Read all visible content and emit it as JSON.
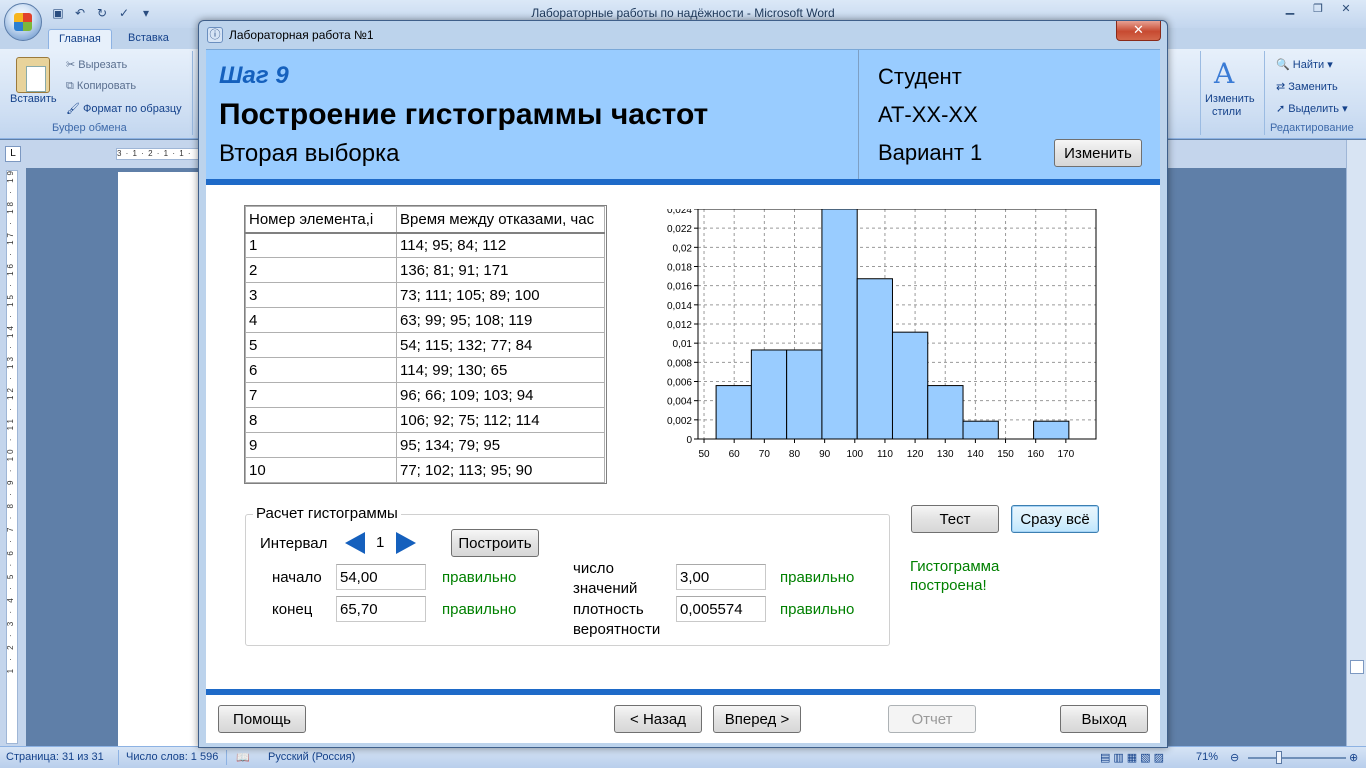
{
  "word": {
    "title": "Лабораторные работы по надёжности - Microsoft Word",
    "tabs": [
      "Главная",
      "Вставка"
    ],
    "clipboard": {
      "paste": "Вставить",
      "cut": "Вырезать",
      "copy": "Копировать",
      "format_painter": "Формат по образцу",
      "group_label": "Буфер обмена"
    },
    "styles": {
      "change_styles_line1": "Изменить",
      "change_styles_line2": "стили"
    },
    "editing": {
      "find": "Найти",
      "replace": "Заменить",
      "select": "Выделить",
      "group_label": "Редактирование"
    },
    "ruler_text": "3 · 1 · 2 · 1 · 1 ·",
    "left_ruler_text": "1 · 2 · 3 · 4 · 5 · 6 · 7 · 8 · 9 · 10 · 11 · 12 · 13 · 14 · 15 · 16 · 17 · 18 · 19",
    "status": {
      "page": "Страница: 31 из 31",
      "words": "Число слов: 1 596",
      "language": "Русский (Россия)",
      "zoom": "71%"
    }
  },
  "dialog": {
    "title": "Лабораторная работа №1",
    "close_glyph": "✕",
    "header": {
      "step": "Шаг 9",
      "title": "Построение гистограммы частот",
      "subtitle": "Вторая выборка",
      "student_label": "Студент",
      "group": "АТ-XX-XX",
      "variant": "Вариант 1",
      "change_button": "Изменить"
    },
    "table": {
      "headers": [
        "Номер элемента,i",
        "Время между отказами, час"
      ],
      "rows": [
        [
          "1",
          "114; 95; 84; 112"
        ],
        [
          "2",
          "136; 81; 91; 171"
        ],
        [
          "3",
          "73; 111; 105; 89; 100"
        ],
        [
          "4",
          "63; 99; 95; 108; 119"
        ],
        [
          "5",
          "54; 115; 132; 77; 84"
        ],
        [
          "6",
          "114; 99; 130; 65"
        ],
        [
          "7",
          "96; 66; 109; 103; 94"
        ],
        [
          "8",
          "106; 92; 75; 112; 114"
        ],
        [
          "9",
          "95; 134; 79; 95"
        ],
        [
          "10",
          "77; 102; 113; 95; 90"
        ]
      ]
    },
    "calc": {
      "group_label": "Расчет гистограммы",
      "interval_label": "Интервал",
      "interval_value": "1",
      "build_button": "Построить",
      "start_label": "начало",
      "start_value": "54,00",
      "start_status": "правильно",
      "end_label": "конец",
      "end_value": "65,70",
      "end_status": "правильно",
      "count_label_line1": "число",
      "count_label_line2": "значений",
      "count_value": "3,00",
      "count_status": "правильно",
      "density_label_line1": "плотность",
      "density_label_line2": "вероятности",
      "density_value": "0,005574",
      "density_status": "правильно"
    },
    "test_button": "Тест",
    "all_button": "Сразу всё",
    "status_message": "Гистограмма построена!",
    "footer": {
      "help": "Помощь",
      "back": "< Назад",
      "next": "Вперед >",
      "report": "Отчет",
      "exit": "Выход"
    }
  },
  "chart_data": {
    "type": "bar",
    "title": "",
    "xlabel": "",
    "ylabel": "",
    "bar_color": "#99ccff",
    "bin_edges": [
      54.0,
      65.7,
      77.4,
      89.1,
      100.8,
      112.5,
      124.2,
      135.9,
      147.6,
      159.3,
      171.0
    ],
    "values": [
      0.005574,
      0.00929,
      0.00929,
      0.024155,
      0.016722,
      0.011148,
      0.005574,
      0.001858,
      0.0,
      0.001858
    ],
    "xlim": [
      48,
      180
    ],
    "ylim": [
      0,
      0.024
    ],
    "x_ticks": [
      50,
      60,
      70,
      80,
      90,
      100,
      110,
      120,
      130,
      140,
      150,
      160,
      170
    ],
    "y_ticks": [
      0,
      0.002,
      0.004,
      0.006,
      0.008,
      0.01,
      0.012,
      0.014,
      0.016,
      0.018,
      0.02,
      0.022,
      0.024
    ],
    "y_tick_labels": [
      "0",
      "0,002",
      "0,004",
      "0,006",
      "0,008",
      "0,01",
      "0,012",
      "0,014",
      "0,016",
      "0,018",
      "0,02",
      "0,022",
      "0,024"
    ],
    "grid": true
  }
}
